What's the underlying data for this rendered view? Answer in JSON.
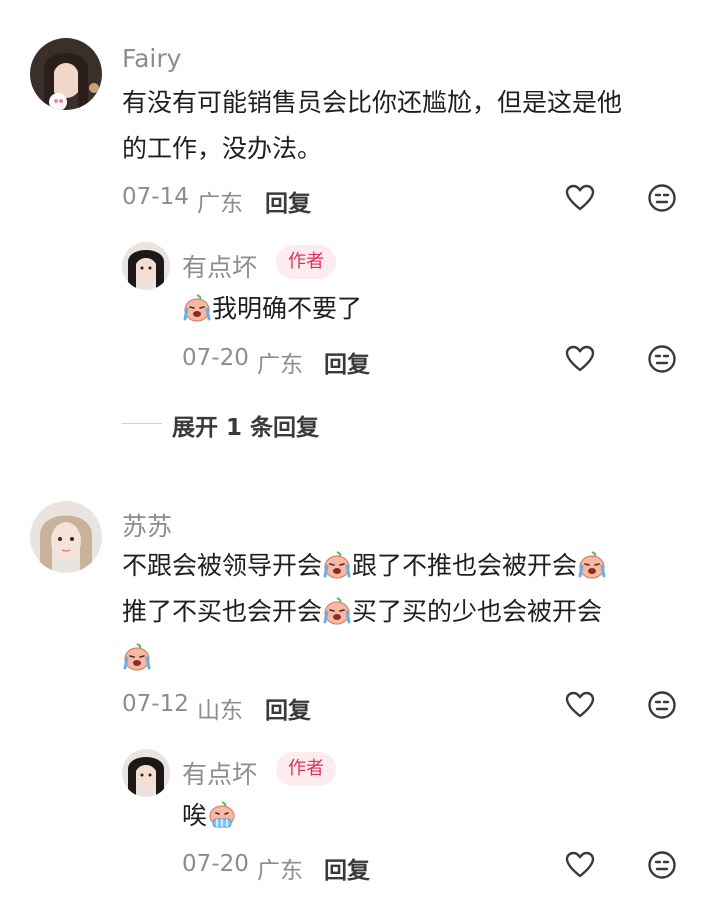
{
  "comments": [
    {
      "user": "Fairy",
      "lines": [
        "有没有可能销售员会比你还尴尬，但是这是他",
        "的工作，没办法。"
      ],
      "date": "07-14",
      "location": "广东",
      "reply_label": "回复",
      "replies": [
        {
          "user": "有点坏",
          "badge": "作者",
          "segments": [
            "",
            "我明确不要了"
          ],
          "date": "07-20",
          "location": "广东",
          "reply_label": "回复"
        }
      ],
      "expand_label": "展开 1 条回复"
    },
    {
      "user": "苏苏",
      "line1": [
        "不跟会被领导开会",
        "跟了不推也会被开会"
      ],
      "line2": [
        "推了不买也会开会",
        "买了买的少也会被开会"
      ],
      "date": "07-12",
      "location": "山东",
      "reply_label": "回复",
      "replies": [
        {
          "user": "有点坏",
          "badge": "作者",
          "text": "唉",
          "date": "07-20",
          "location": "广东",
          "reply_label": "回复"
        }
      ]
    }
  ],
  "icons": {
    "like": "heart-outline-icon",
    "dislike": "neutral-face-icon",
    "emoji_crying": "crying-face-emoji",
    "emoji_sigh": "sigh-face-emoji"
  },
  "colors": {
    "badge_bg": "#fdecef",
    "badge_text": "#e1305a",
    "meta_text": "#8d8d8d"
  }
}
